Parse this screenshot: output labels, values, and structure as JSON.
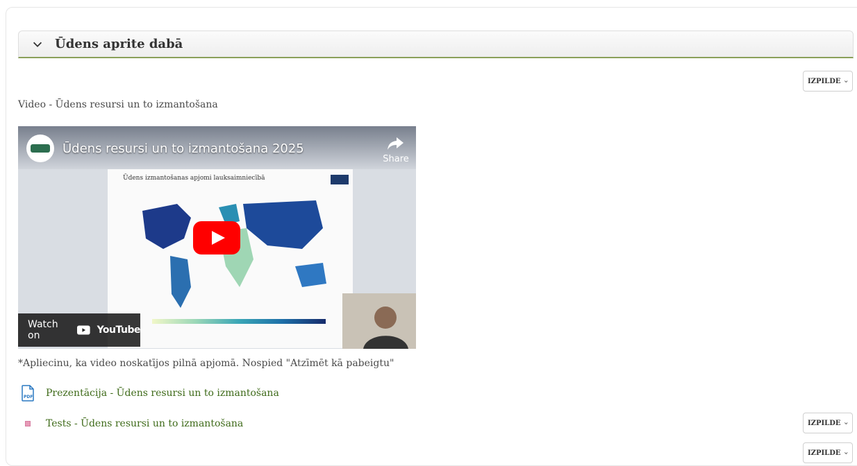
{
  "section": {
    "title": "Ūdens aprite dabā"
  },
  "completion": {
    "label": "IZPILDE"
  },
  "video_caption": "Video - Ūdens resursi un to izmantošana",
  "video": {
    "title": "Ūdens resursi un to izmantošana 2025",
    "channel_logo_text": "Water IP",
    "share_label": "Share",
    "watch_on_label": "Watch on",
    "youtube_label": "YouTube",
    "slide_title": "Ūdens izmantošanas apjomi lauksaimniecībā"
  },
  "confirmation_text": "*Apliecinu, ka video noskatījos pilnā apjomā. Nospied \"Atzīmēt kā pabeigtu\"",
  "activities": [
    {
      "label": "Prezentācija - Ūdens resursi un to izmantošana",
      "icon": "pdf-icon"
    },
    {
      "label": "Tests - Ūdens resursi un to izmantošana",
      "icon": "quiz-icon"
    }
  ],
  "colors": {
    "link": "#3f6b1a",
    "header_border": "#8aa05a",
    "youtube_red": "#ff0000"
  }
}
